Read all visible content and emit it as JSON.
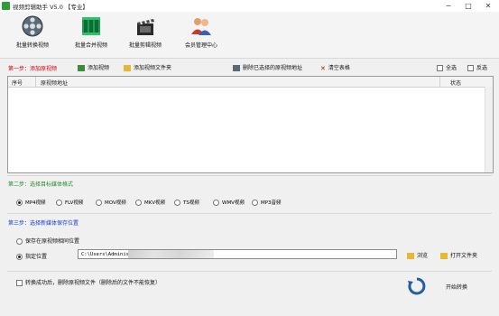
{
  "window": {
    "title": "视频剪辑助手 V5.0 【专业】",
    "minimize": "─",
    "maximize": "□",
    "close": "✕"
  },
  "toolbar": {
    "items": [
      {
        "label": "批量转换视频",
        "icon": "film-reel-icon"
      },
      {
        "label": "批量合并视频",
        "icon": "merge-film-icon"
      },
      {
        "label": "批量剪辑视频",
        "icon": "clapperboard-icon"
      },
      {
        "label": "会员管理中心",
        "icon": "users-icon"
      }
    ]
  },
  "step1": {
    "label": "第一步：添加原视频",
    "add_video": "添加视频",
    "add_folder": "添加视频文件夹",
    "remove_selected": "删除已选择的原视频地址",
    "clear_table": "清空表格",
    "select_all": "全选",
    "invert_select": "反选"
  },
  "table": {
    "columns": [
      "序号",
      "原视频地址",
      "状态"
    ],
    "rows": []
  },
  "step2": {
    "label": "第二步：选择目标媒体格式",
    "formats": [
      "MP4视频",
      "FLV视频",
      "MOV视频",
      "MKV视频",
      "TS视频",
      "WMV视频",
      "MP3音频"
    ],
    "selected": "MP4视频"
  },
  "step3": {
    "label": "第三步：选择新媒体保存位置",
    "option_same": "保存在原视频相同位置",
    "option_custom": "指定位置",
    "path_value": "C:\\Users\\Administrat",
    "browse": "浏览",
    "open_folder": "打开文件夹"
  },
  "footer": {
    "delete_after": "转换成功后，删除原视频文件（删除后的文件不能恢复）",
    "start": "开始转换"
  },
  "colors": {
    "step1": "#d00000",
    "step2": "#2a8a2a",
    "step3": "#1a3ec8",
    "accent": "#1f5fa8"
  }
}
